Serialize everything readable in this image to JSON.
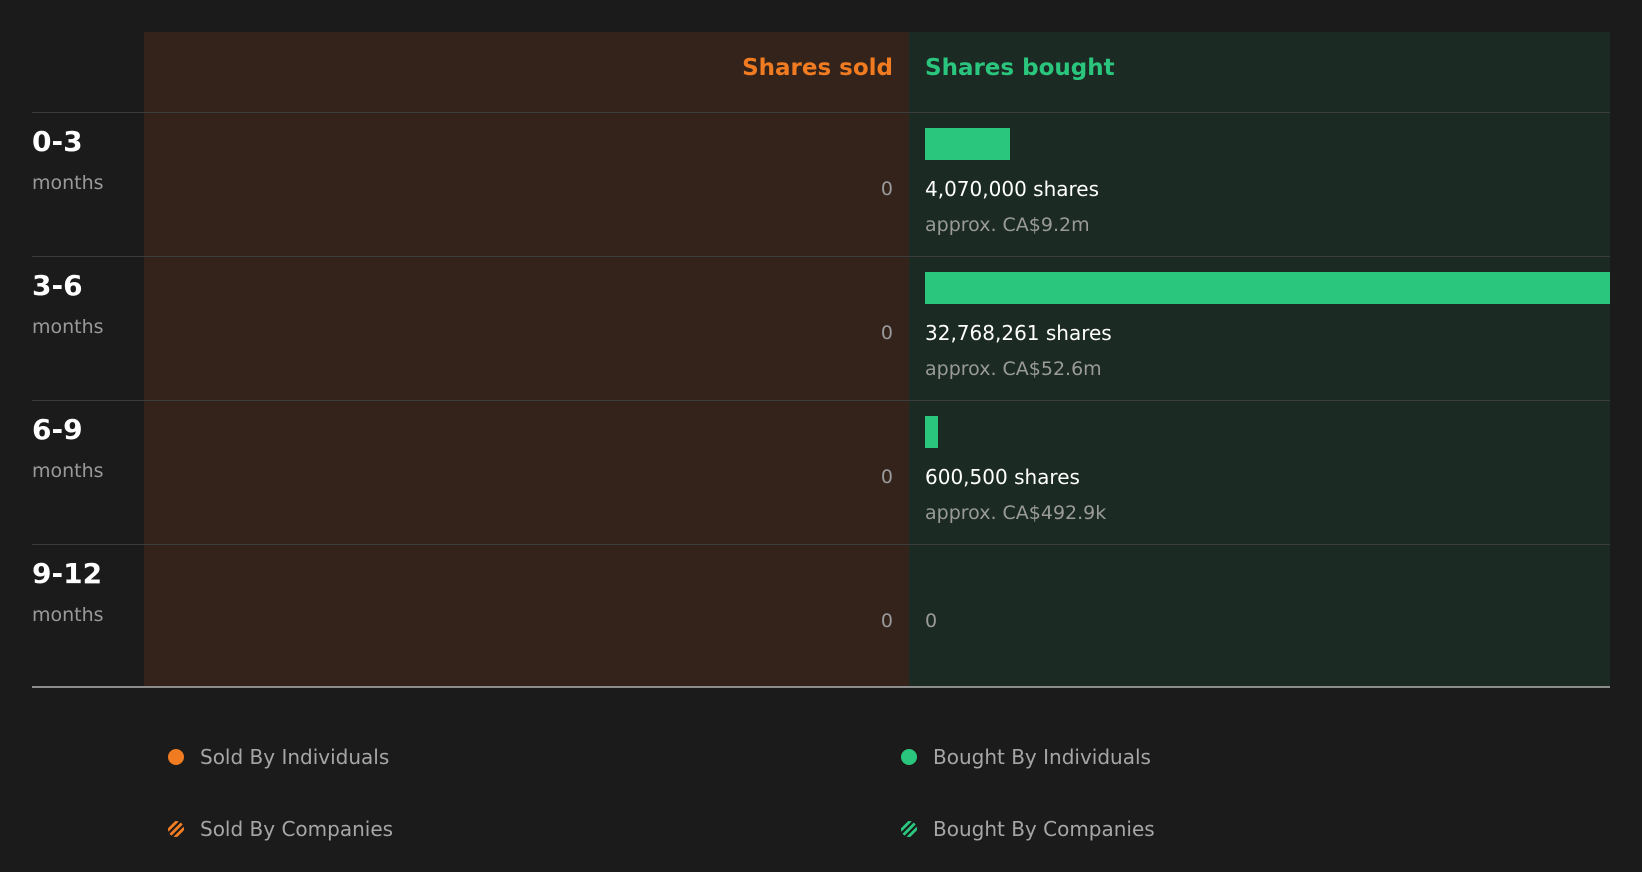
{
  "colors": {
    "sold": "#f07b21",
    "bought": "#2bc67e",
    "sold_bg": "#33231b",
    "bought_bg": "#1b2a23",
    "page_bg": "#1b1b1b"
  },
  "chart_data": {
    "type": "bar",
    "columns": {
      "sold": "Shares sold",
      "bought": "Shares bought"
    },
    "categories": [
      {
        "label": "0-3",
        "unit": "months",
        "sold": "0",
        "bought_shares": 4070000,
        "bought_text": "4,070,000 shares",
        "bought_approx": "approx. CA$9.2m",
        "bought_zero": ""
      },
      {
        "label": "3-6",
        "unit": "months",
        "sold": "0",
        "bought_shares": 32768261,
        "bought_text": "32,768,261 shares",
        "bought_approx": "approx. CA$52.6m",
        "bought_zero": ""
      },
      {
        "label": "6-9",
        "unit": "months",
        "sold": "0",
        "bought_shares": 600500,
        "bought_text": "600,500 shares",
        "bought_approx": "approx. CA$492.9k",
        "bought_zero": ""
      },
      {
        "label": "9-12",
        "unit": "months",
        "sold": "0",
        "bought_shares": 0,
        "bought_text": "",
        "bought_approx": "",
        "bought_zero": "0"
      }
    ],
    "series": [
      {
        "name": "Shares bought",
        "values": [
          4070000,
          32768261,
          600500,
          0
        ]
      },
      {
        "name": "Shares sold",
        "values": [
          0,
          0,
          0,
          0
        ]
      }
    ],
    "legend": {
      "placement": "bottom",
      "items": [
        {
          "label": "Sold By Individuals",
          "style": "solid",
          "color": "#f07b21"
        },
        {
          "label": "Bought By Individuals",
          "style": "solid",
          "color": "#2bc67e"
        },
        {
          "label": "Sold By Companies",
          "style": "striped",
          "color": "#f07b21"
        },
        {
          "label": "Bought By Companies",
          "style": "striped",
          "color": "#2bc67e"
        }
      ]
    }
  }
}
